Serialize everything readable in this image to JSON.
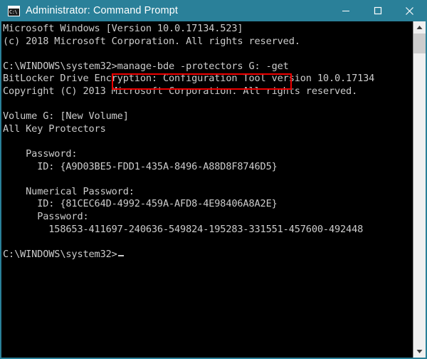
{
  "window": {
    "title": "Administrator: Command Prompt",
    "icon_name": "command-prompt-icon",
    "icon_text": "C:\\",
    "titlebar_color": "#2a8099",
    "console_bg": "#000000",
    "console_fg": "#cccccc",
    "controls": {
      "minimize_label": "Minimize",
      "maximize_label": "Maximize",
      "close_label": "Close"
    }
  },
  "console": {
    "lines": [
      "Microsoft Windows [Version 10.0.17134.523]",
      "(c) 2018 Microsoft Corporation. All rights reserved.",
      "",
      "C:\\WINDOWS\\system32>manage-bde -protectors G: -get",
      "BitLocker Drive Encryption: Configuration Tool version 10.0.17134",
      "Copyright (C) 2013 Microsoft Corporation. All rights reserved.",
      "",
      "Volume G: [New Volume]",
      "All Key Protectors",
      "",
      "    Password:",
      "      ID: {A9D03BE5-FDD1-435A-8496-A88D8F8746D5}",
      "",
      "    Numerical Password:",
      "      ID: {81CEC64D-4992-459A-AFD8-4E98406A8A2E}",
      "      Password:",
      "        158653-411697-240636-549824-195283-331551-457600-492448",
      "",
      "C:\\WINDOWS\\system32>"
    ],
    "full_text": "Microsoft Windows [Version 10.0.17134.523]\n(c) 2018 Microsoft Corporation. All rights reserved.\n\nC:\\WINDOWS\\system32>manage-bde -protectors G: -get\nBitLocker Drive Encryption: Configuration Tool version 10.0.17134\nCopyright (C) 2013 Microsoft Corporation. All rights reserved.\n\nVolume G: [New Volume]\nAll Key Protectors\n\n    Password:\n      ID: {A9D03BE5-FDD1-435A-8496-A88D8F8746D5}\n\n    Numerical Password:\n      ID: {81CEC64D-4992-459A-AFD8-4E98406A8A2E}\n      Password:\n        158653-411697-240636-549824-195283-331551-457600-492448\n\nC:\\WINDOWS\\system32>",
    "prompt": "C:\\WINDOWS\\system32>",
    "command": "manage-bde -protectors G: -get",
    "highlight_color": "#ee0000",
    "details": {
      "os_version": "10.0.17134.523",
      "copyright_os": "(c) 2018 Microsoft Corporation. All rights reserved.",
      "tool_version": "10.0.17134",
      "copyright_tool": "Copyright (C) 2013 Microsoft Corporation. All rights reserved.",
      "volume": "Volume G: [New Volume]",
      "protectors_header": "All Key Protectors",
      "password_id": "{A9D03BE5-FDD1-435A-8496-A88D8F8746D5}",
      "numerical_password_id": "{81CEC64D-4992-459A-AFD8-4E98406A8A2E}",
      "recovery_key": "158653-411697-240636-549824-195283-331551-457600-492448"
    }
  },
  "scrollbar": {
    "up_arrow_name": "scroll-up-arrow",
    "down_arrow_name": "scroll-down-arrow",
    "thumb_name": "scrollbar-thumb"
  }
}
